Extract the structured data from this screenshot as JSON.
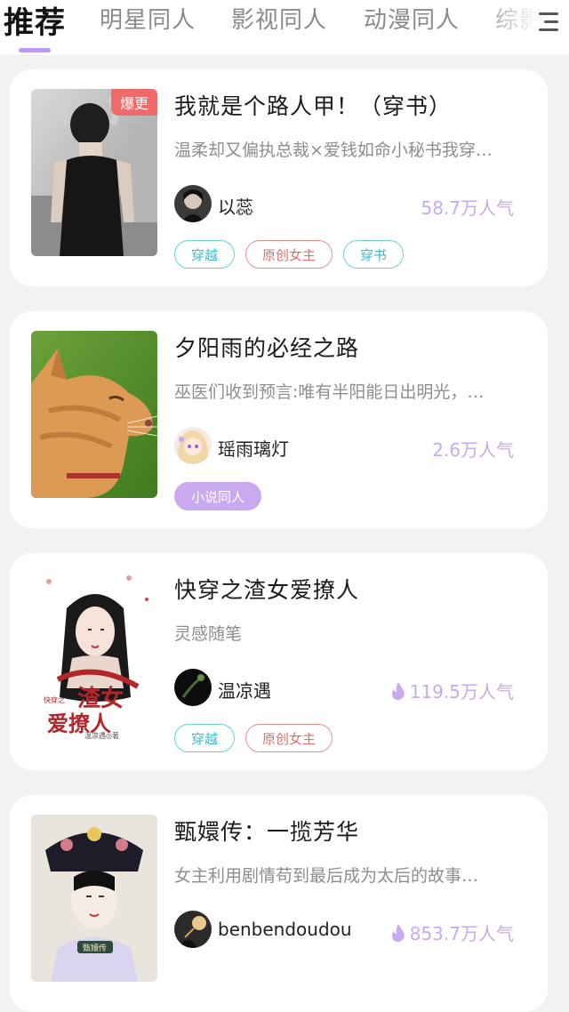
{
  "tabs": [
    {
      "label": "推荐",
      "active": true
    },
    {
      "label": "明星同人",
      "active": false
    },
    {
      "label": "影视同人",
      "active": false
    },
    {
      "label": "动漫同人",
      "active": false
    },
    {
      "label": "综影",
      "active": false
    }
  ],
  "menu_icon": "hamburger-menu-icon",
  "colors": {
    "accent": "#b89af2",
    "badge": "#f06a6a",
    "popularity": "#c7aaf0",
    "tag_cyan": "#3fb9c9",
    "tag_red": "#e0706a",
    "tag_purple": "#c9a9ef"
  },
  "cards": [
    {
      "badge": "爆更",
      "title": "我就是个路人甲！（穿书）",
      "summary": "温柔却又偏执总裁×爱钱如命小秘书我穿…",
      "author": "以蕊",
      "popularity": "58.7万人气",
      "hot": false,
      "tags": [
        "穿越",
        "原创女主",
        "穿书"
      ]
    },
    {
      "badge": "",
      "title": "夕阳雨的必经之路",
      "summary": "巫医们收到预言:唯有半阳能日出明光，…",
      "author": "瑶雨璃灯",
      "popularity": "2.6万人气",
      "hot": false,
      "tags": [
        "小说同人"
      ]
    },
    {
      "badge": "",
      "title": "快穿之渣女爱撩人",
      "summary": "灵感随笔",
      "author": "温凉遇",
      "popularity": "119.5万人气",
      "hot": true,
      "tags": [
        "穿越",
        "原创女主"
      ],
      "cover_text": {
        "main1": "渣女",
        "main2": "爱撩人",
        "small": "快穿之",
        "footer": "温凉遇◎著"
      }
    },
    {
      "badge": "",
      "title": "甄嬛传：一揽芳华",
      "summary": "女主利用剧情苟到最后成为太后的故事…",
      "author": "benbendoudou",
      "popularity": "853.7万人气",
      "hot": true,
      "tags": [],
      "cover_text": {
        "small": "甄嬛传"
      }
    }
  ]
}
